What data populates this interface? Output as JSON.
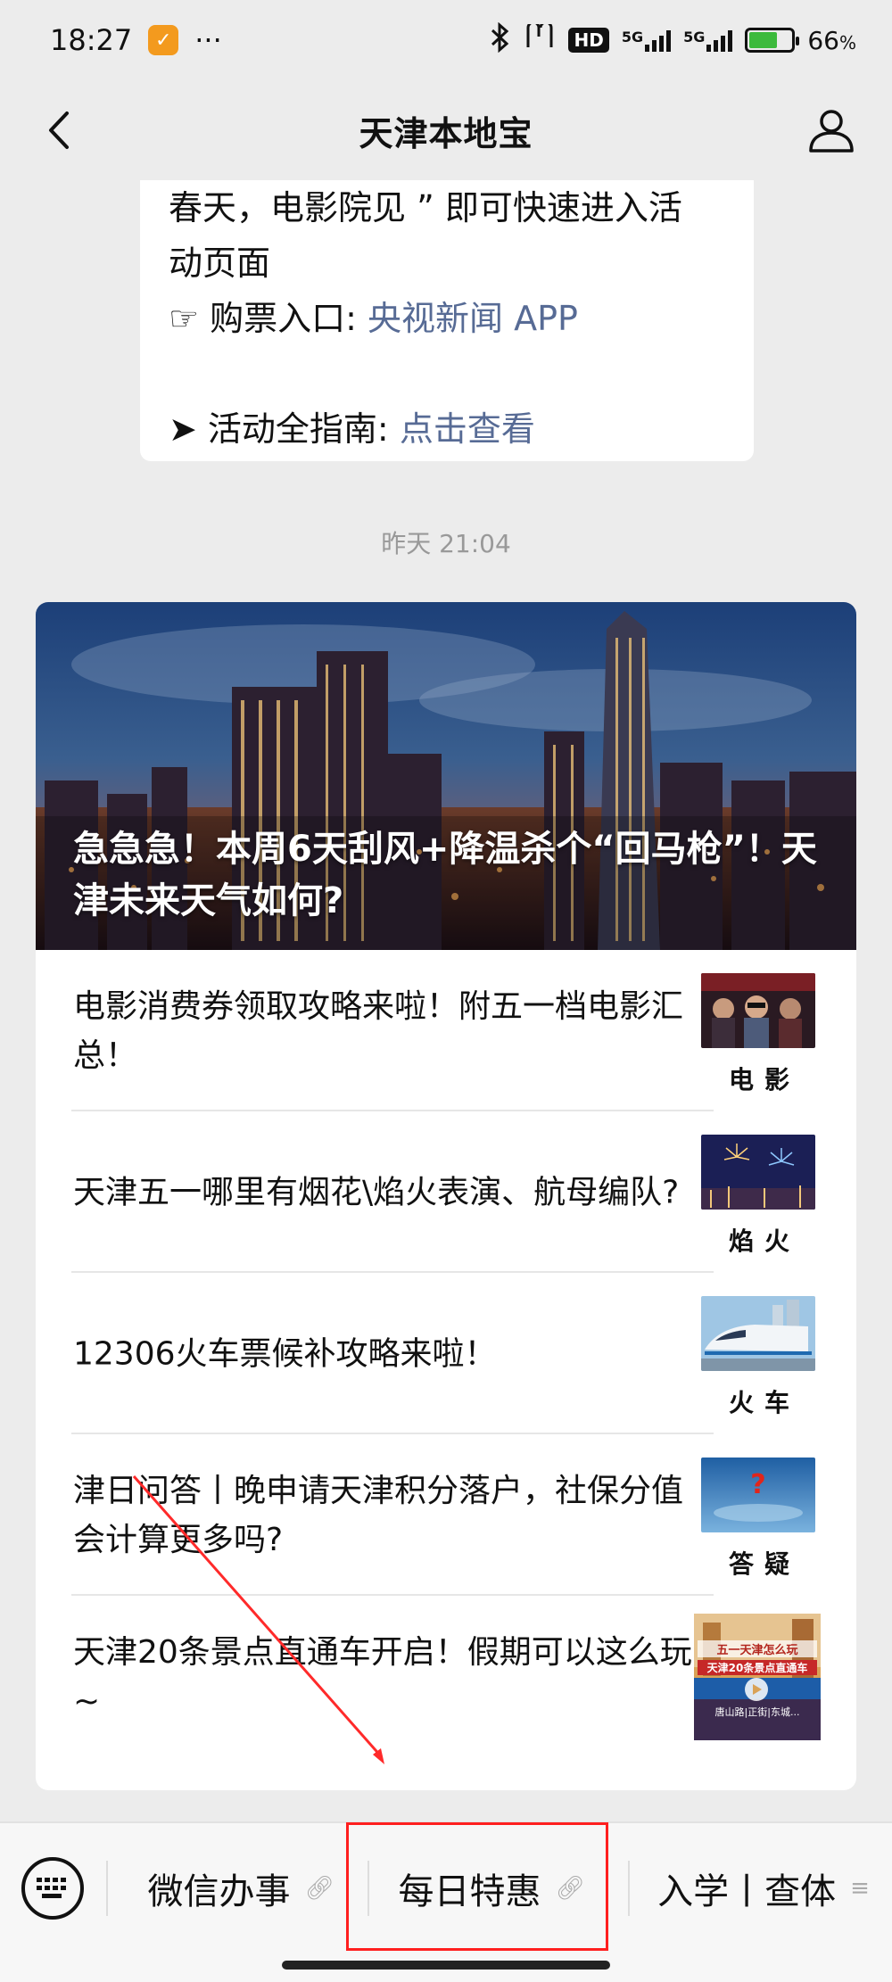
{
  "status_bar": {
    "time": "18:27",
    "more_dots": "···",
    "hd_label": "HD",
    "net_1": "5G",
    "net_2": "5G",
    "battery_percent": "66",
    "battery_unit": "%",
    "battery_level": 0.66
  },
  "nav": {
    "title": "天津本地宝"
  },
  "prev_message": {
    "line1": "春天，电影院见 ” 即可快速进入活",
    "line2": "动页面",
    "ticket_prefix": "☞ 购票入口: ",
    "ticket_link": "央视新闻 APP",
    "guide_prefix": "➤ 活动全指南: ",
    "guide_link": "点击查看"
  },
  "timestamp": "昨天 21:04",
  "article": {
    "hero_title": "急急急！本周6天刮风+降温杀个“回马枪”！天津未来天气如何?",
    "items": [
      {
        "title": "电影消费券领取攻略来啦！附五一档电影汇总！",
        "thumb_label": "电影"
      },
      {
        "title": "天津五一哪里有烟花\\焰火表演、航母编队?",
        "thumb_label": "焰火"
      },
      {
        "title": "12306火车票候补攻略来啦！",
        "thumb_label": "火车"
      },
      {
        "title": "津日问答丨晚申请天津积分落户，社保分值会计算更多吗?",
        "thumb_label": "答疑"
      },
      {
        "title": "天津20条景点直通车开启！假期可以这么玩~",
        "thumb_line1": "五一天津怎么玩",
        "thumb_line2": "天津20条景点直通车",
        "thumb_line3": "唐山路|正街|东城..."
      }
    ]
  },
  "bottom_menu": {
    "items": [
      {
        "label": "微信办事"
      },
      {
        "label": "每日特惠"
      },
      {
        "label": "入学丨查体"
      }
    ]
  },
  "colors": {
    "link": "#576b95",
    "highlight": "#ff1f1f",
    "background": "#ececec"
  }
}
